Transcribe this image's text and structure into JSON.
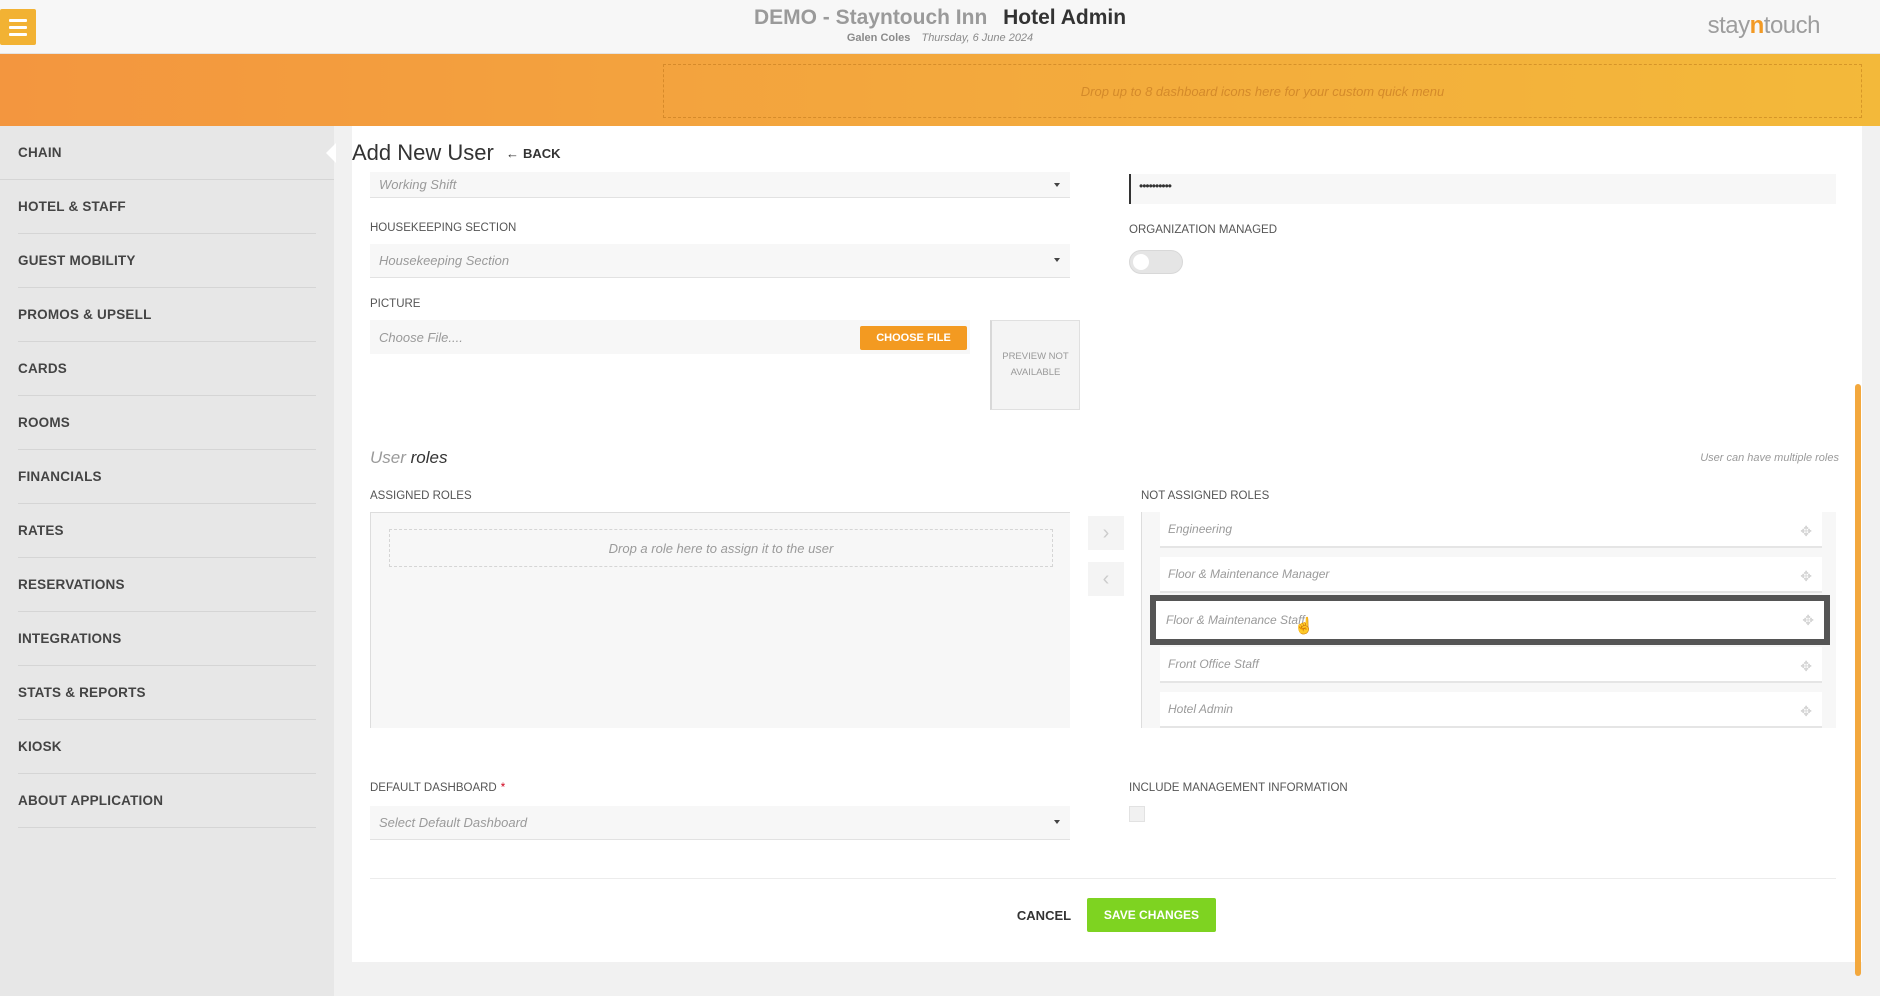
{
  "header": {
    "hotel_name": "DEMO - Stayntouch Inn",
    "app_title": "Hotel Admin",
    "user_name": "Galen Coles",
    "date": "Thursday, 6 June 2024",
    "logo_left": "stay",
    "logo_mid": "n",
    "logo_right": "touch"
  },
  "banner": {
    "dropzone_text": "Drop up to 8 dashboard icons here for your custom quick menu"
  },
  "sidebar": {
    "items": [
      {
        "label": "CHAIN"
      },
      {
        "label": "HOTEL & STAFF"
      },
      {
        "label": "GUEST MOBILITY"
      },
      {
        "label": "PROMOS & UPSELL"
      },
      {
        "label": "CARDS"
      },
      {
        "label": "ROOMS"
      },
      {
        "label": "FINANCIALS"
      },
      {
        "label": "RATES"
      },
      {
        "label": "RESERVATIONS"
      },
      {
        "label": "INTEGRATIONS"
      },
      {
        "label": "STATS & REPORTS"
      },
      {
        "label": "KIOSK"
      },
      {
        "label": "ABOUT APPLICATION"
      }
    ]
  },
  "page": {
    "title": "Add New User",
    "back_label": "BACK"
  },
  "form": {
    "working_shift_placeholder": "Working Shift",
    "password_value": "••••••••••",
    "housekeeping_label": "HOUSEKEEPING SECTION",
    "housekeeping_placeholder": "Housekeeping Section",
    "org_managed_label": "ORGANIZATION MANAGED",
    "org_managed_on": false,
    "picture_label": "PICTURE",
    "file_placeholder": "Choose File....",
    "choose_file_label": "CHOOSE FILE",
    "preview_text": "PREVIEW NOT AVAILABLE",
    "default_dashboard_label": "DEFAULT DASHBOARD",
    "required_mark": "*",
    "default_dashboard_placeholder": "Select Default Dashboard",
    "include_mgmt_label": "INCLUDE MANAGEMENT INFORMATION",
    "include_mgmt_checked": false
  },
  "roles": {
    "title_light": "User",
    "title_strong": "roles",
    "note": "User can have multiple roles",
    "assigned_label": "ASSIGNED ROLES",
    "assigned_drop_text": "Drop a role here to assign it to the user",
    "not_assigned_label": "NOT ASSIGNED ROLES",
    "not_assigned": [
      "Engineering",
      "Floor & Maintenance Manager",
      "Floor & Maintenance Staff",
      "Front Office Staff",
      "Hotel Admin"
    ],
    "move_right_icon": "›",
    "move_left_icon": "‹",
    "move_handle_icon": "✥"
  },
  "actions": {
    "cancel_label": "CANCEL",
    "save_label": "SAVE CHANGES"
  },
  "colors": {
    "accent_orange": "#f39a21",
    "save_green": "#7ed321"
  }
}
